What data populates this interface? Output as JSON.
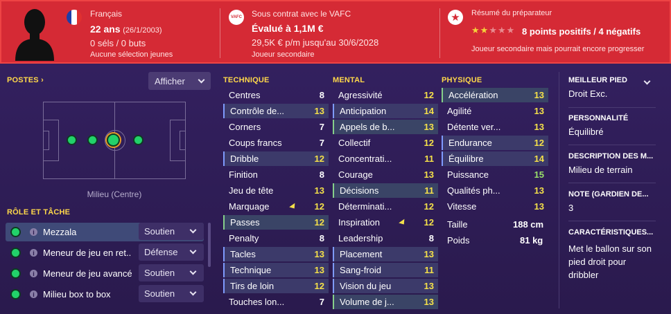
{
  "header": {
    "nationality": "Français",
    "age": "22 ans",
    "birthdate": "(26/1/2003)",
    "caps": "0 séls / 0 buts",
    "youth": "Aucune sélection jeunes",
    "contract": "Sous contrat avec le VAFC",
    "club_badge": "VAFC",
    "value": "Évalué à 1,1M €",
    "wage": "29,5K € p/m jusqu'au 30/6/2028",
    "squad_status": "Joueur secondaire",
    "coach_title": "Résumé du préparateur",
    "coach_stars": 2,
    "coach_stars_max": 5,
    "coach_summary": "8 points positifs / 4 négatifs",
    "coach_note": "Joueur secondaire mais pourrait encore progresser",
    "colors": {
      "header_bg": "#d52a35",
      "accent": "#ffd84a"
    }
  },
  "positions": {
    "title": "POSTES",
    "show_button": "Afficher",
    "pitch_label": "Milieu (Centre)"
  },
  "roles": {
    "title": "RÔLE ET TÂCHE",
    "items": [
      {
        "name": "Mezzala",
        "duty": "Soutien"
      },
      {
        "name": "Meneur de jeu en ret...",
        "duty": "Défense"
      },
      {
        "name": "Meneur de jeu avancé",
        "duty": "Soutien"
      },
      {
        "name": "Milieu box to box",
        "duty": "Soutien"
      }
    ]
  },
  "technique": {
    "title": "TECHNIQUE",
    "items": [
      {
        "name": "Centres",
        "value": "8"
      },
      {
        "name": "Contrôle de...",
        "value": "13"
      },
      {
        "name": "Corners",
        "value": "7"
      },
      {
        "name": "Coups francs",
        "value": "7"
      },
      {
        "name": "Dribble",
        "value": "12"
      },
      {
        "name": "Finition",
        "value": "8"
      },
      {
        "name": "Jeu de tête",
        "value": "13"
      },
      {
        "name": "Marquage",
        "value": "12"
      },
      {
        "name": "Passes",
        "value": "12"
      },
      {
        "name": "Penalty",
        "value": "8"
      },
      {
        "name": "Tacles",
        "value": "13"
      },
      {
        "name": "Technique",
        "value": "13"
      },
      {
        "name": "Tirs de loin",
        "value": "12"
      },
      {
        "name": "Touches lon...",
        "value": "7"
      }
    ]
  },
  "mental": {
    "title": "MENTAL",
    "items": [
      {
        "name": "Agressivité",
        "value": "12"
      },
      {
        "name": "Anticipation",
        "value": "14"
      },
      {
        "name": "Appels de b...",
        "value": "13"
      },
      {
        "name": "Collectif",
        "value": "12"
      },
      {
        "name": "Concentrati...",
        "value": "11"
      },
      {
        "name": "Courage",
        "value": "13"
      },
      {
        "name": "Décisions",
        "value": "11"
      },
      {
        "name": "Déterminati...",
        "value": "12"
      },
      {
        "name": "Inspiration",
        "value": "12"
      },
      {
        "name": "Leadership",
        "value": "8"
      },
      {
        "name": "Placement",
        "value": "13"
      },
      {
        "name": "Sang-froid",
        "value": "11"
      },
      {
        "name": "Vision du jeu",
        "value": "13"
      },
      {
        "name": "Volume de j...",
        "value": "13"
      }
    ]
  },
  "physique": {
    "title": "PHYSIQUE",
    "items": [
      {
        "name": "Accélération",
        "value": "13"
      },
      {
        "name": "Agilité",
        "value": "13"
      },
      {
        "name": "Détente ver...",
        "value": "13"
      },
      {
        "name": "Endurance",
        "value": "12"
      },
      {
        "name": "Équilibre",
        "value": "14"
      },
      {
        "name": "Puissance",
        "value": "15"
      },
      {
        "name": "Qualités ph...",
        "value": "13"
      },
      {
        "name": "Vitesse",
        "value": "13"
      }
    ],
    "height_label": "Taille",
    "height_value": "188 cm",
    "weight_label": "Poids",
    "weight_value": "81 kg"
  },
  "info": {
    "foot_title": "MEILLEUR PIED",
    "foot_value": "Droit Exc.",
    "personality_title": "PERSONNALITÉ",
    "personality_value": "Équilibré",
    "description_title": "DESCRIPTION DES M...",
    "description_value": "Milieu de terrain",
    "gk_title": "NOTE (GARDIEN DE...",
    "gk_value": "3",
    "traits_title": "CARACTÉRISTIQUES...",
    "traits_value": "Met le ballon sur son pied droit pour dribbler"
  }
}
